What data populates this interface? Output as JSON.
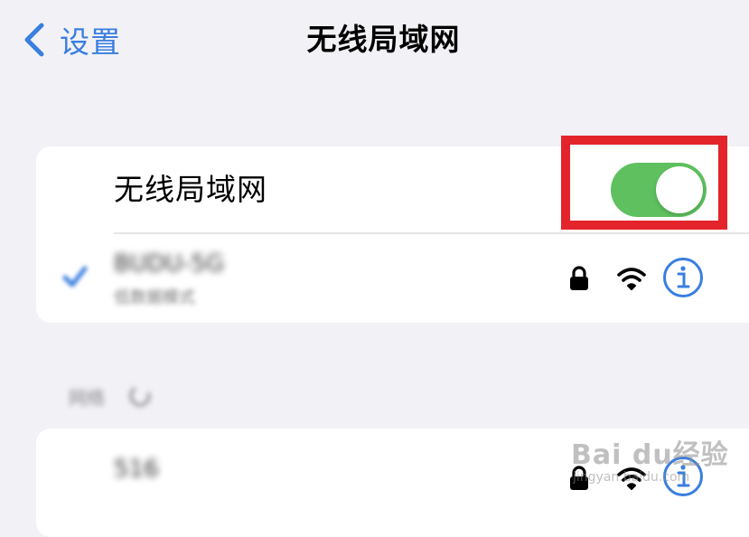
{
  "nav": {
    "back_label": "设置",
    "title": "无线局域网"
  },
  "wifi_toggle": {
    "label": "无线局域网",
    "state": "on",
    "on_color": "#5ec05f",
    "highlight_color": "#e3242b"
  },
  "connected_network": {
    "name": "BUDU-5G",
    "subtitle": "低数据模式",
    "icons": [
      "checkmark-icon",
      "lock-icon",
      "wifi-icon",
      "info-icon"
    ]
  },
  "section_header": {
    "label": "网络",
    "icon": "spinner-icon"
  },
  "other_networks": [
    {
      "name": "516",
      "icons": [
        "lock-icon",
        "wifi-icon",
        "info-icon"
      ]
    }
  ],
  "watermark": {
    "main": "Bai du经验",
    "sub": "jingyan.baidu.com"
  },
  "colors": {
    "accent": "#3a7ee0",
    "background": "#f2f2f6",
    "card": "#ffffff"
  }
}
